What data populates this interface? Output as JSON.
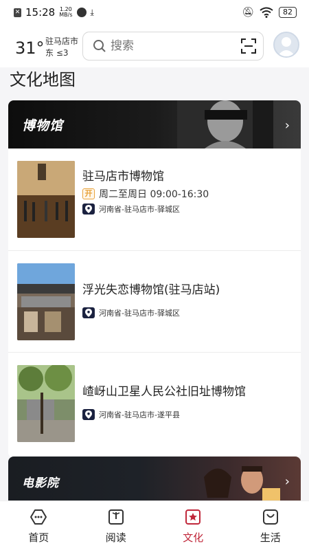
{
  "status_bar": {
    "time": "15:28",
    "speed_value": "1.20",
    "speed_unit": "MB/s",
    "battery": "82"
  },
  "header": {
    "temperature": "31°",
    "city": "驻马店市",
    "wind": "东 ≤3",
    "search_placeholder": "搜索"
  },
  "section_title": "文化地图",
  "museum_card": {
    "title": "博物馆",
    "items": [
      {
        "name": "驻马店市博物馆",
        "hours_badge": "开",
        "hours": "周二至周日 09:00-16:30",
        "address": "河南省-驻马店市-驿城区"
      },
      {
        "name": "浮光失恋博物馆(驻马店站)",
        "address": "河南省-驻马店市-驿城区"
      },
      {
        "name": "嵖岈山卫星人民公社旧址博物馆",
        "address": "河南省-驻马店市-遂平县"
      }
    ]
  },
  "cinema_card": {
    "title": "电影院"
  },
  "bottom_nav": [
    {
      "label": "首页",
      "icon": "home-icon"
    },
    {
      "label": "阅读",
      "icon": "book-icon"
    },
    {
      "label": "文化",
      "icon": "culture-icon",
      "active": true
    },
    {
      "label": "生活",
      "icon": "life-icon"
    }
  ],
  "colors": {
    "accent": "#c0273a",
    "open_badge": "#e8a23a",
    "pin": "#1b2240"
  }
}
